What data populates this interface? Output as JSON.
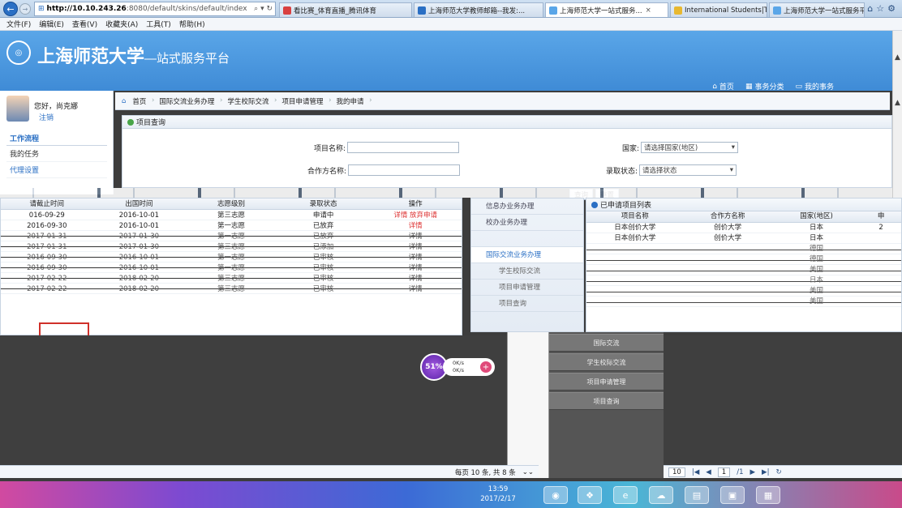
{
  "browser": {
    "address_host": "http://10.10.243.26",
    "address_path": ":8080/default/skins/default/index",
    "tabs": [
      {
        "label": "看比赛_体育直播_腾讯体育",
        "color": "#d94040"
      },
      {
        "label": "上海师范大学教师邮箱--我发:...",
        "color": "#2a6fc4"
      },
      {
        "label": "上海师范大学一站式服务...",
        "color": "#5aa6e8"
      },
      {
        "label": "International Students|Toky...",
        "color": "#e8b830"
      },
      {
        "label": "上海师范大学一站式服务平台",
        "color": "#5aa6e8"
      }
    ],
    "menu": [
      "文件(F)",
      "编辑(E)",
      "查看(V)",
      "收藏夹(A)",
      "工具(T)",
      "帮助(H)"
    ]
  },
  "header": {
    "title": "上海师范大学",
    "subtitle": "—站式服务平台",
    "links": [
      "首页",
      "事务分类",
      "我的事务"
    ]
  },
  "sidebar": {
    "greeting": "您好，尚克娜",
    "logout": "注销",
    "section_title": "工作流程",
    "items": [
      "我的任务",
      "代理设置"
    ]
  },
  "breadcrumb": [
    "首页",
    "国际交流业务办理",
    "学生校际交流",
    "项目申请管理",
    "我的申请"
  ],
  "query": {
    "title": "项目查询",
    "project_name_label": "项目名称:",
    "partner_label": "合作方名称:",
    "country_label": "国家:",
    "country_placeholder": "请选择国家(地区)",
    "status_label": "录取状态:",
    "status_placeholder": "请选择状态",
    "search_btn": "查询",
    "reset_btn": "重置"
  },
  "left_table": {
    "headers": [
      "请截止时间",
      "出国时间",
      "志愿级别",
      "录取状态",
      "操作"
    ],
    "rows": [
      [
        "016-09-29",
        "2016-10-01",
        "第三志愿",
        "申请中",
        "详情 放弃申请"
      ],
      [
        "2016-09-30",
        "2016-10-01",
        "第一志愿",
        "已放弃",
        "详情"
      ],
      [
        "2017-01-31",
        "2017-01-30",
        "第一志愿",
        "已放弃",
        "详情"
      ],
      [
        "2017-01-31",
        "2017-01-30",
        "第三志愿",
        "已添加",
        "详情"
      ],
      [
        "2016-09-30",
        "2016-10-01",
        "第一志愿",
        "已审核",
        "详情"
      ],
      [
        "2016-09-30",
        "2016-10-01",
        "第一志愿",
        "已审核",
        "详情"
      ],
      [
        "2017-02-22",
        "2018-02-20",
        "第三志愿",
        "已审核",
        "详情"
      ],
      [
        "2017-02-22",
        "2018-02-20",
        "第三志愿",
        "已审核",
        "详情"
      ]
    ]
  },
  "mid_menu": [
    "信息办业务办理",
    "校办业务办理",
    "",
    "国际交流业务办理",
    "学生校际交流",
    "项目申请管理",
    "项目查询"
  ],
  "result": {
    "title": "已申请项目列表",
    "headers": [
      "项目名称",
      "合作方名称",
      "国家(地区)",
      "申"
    ],
    "rows": [
      [
        "日本创价大学",
        "创价大学",
        "日本",
        "2"
      ],
      [
        "日本创价大学",
        "创价大学",
        "日本",
        ""
      ],
      [
        "",
        "",
        "德国",
        ""
      ],
      [
        "",
        "",
        "德国",
        ""
      ],
      [
        "",
        "",
        "美国",
        ""
      ],
      [
        "",
        "",
        "日本",
        ""
      ],
      [
        "",
        "",
        "美国",
        ""
      ],
      [
        "",
        "",
        "美国",
        ""
      ]
    ]
  },
  "dark_menu": [
    "国际交流",
    "学生校际交流",
    "项目申请管理",
    "项目查询"
  ],
  "net_widget": {
    "percent": "51%",
    "up": "0K/s",
    "down": "0K/s"
  },
  "pager_left": "每页 10 条, 共 8 条",
  "pager_right": {
    "size": "10",
    "page": "1",
    "total": "/1"
  },
  "clock": {
    "time": "13:59",
    "date": "2017/2/17"
  }
}
